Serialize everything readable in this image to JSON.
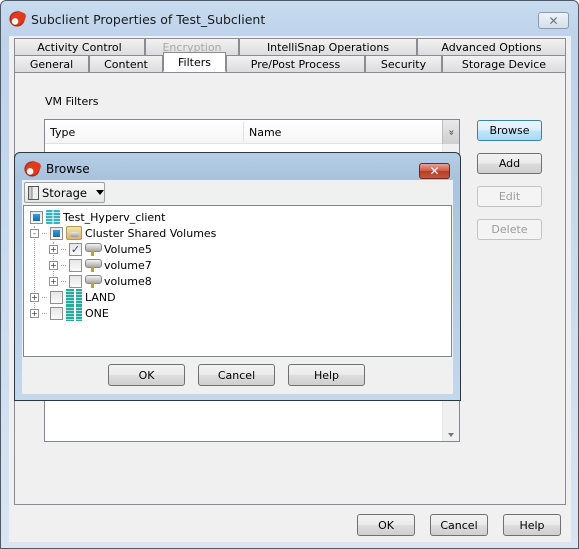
{
  "window": {
    "title": "Subclient Properties of Test_Subclient",
    "close_glyph": "✕"
  },
  "tabs": {
    "row_back": [
      {
        "label": "Activity Control",
        "disabled": false
      },
      {
        "label": "Encryption",
        "disabled": true
      },
      {
        "label": "IntelliSnap Operations",
        "disabled": false
      },
      {
        "label": "Advanced Options",
        "disabled": false
      }
    ],
    "row_front": [
      {
        "label": "General",
        "active": false
      },
      {
        "label": "Content",
        "active": false
      },
      {
        "label": "Filters",
        "active": true
      },
      {
        "label": "Pre/Post Process",
        "active": false
      },
      {
        "label": "Security",
        "active": false
      },
      {
        "label": "Storage Device",
        "active": false
      }
    ]
  },
  "filters": {
    "section_label": "VM Filters",
    "columns": [
      "Type",
      "Name"
    ],
    "more_columns_glyph": "»",
    "buttons": {
      "browse": "Browse",
      "add": "Add",
      "edit": "Edit",
      "delete": "Delete"
    }
  },
  "browse_dialog": {
    "title": "Browse",
    "close_glyph": "✕",
    "view_dropdown": "Storage",
    "tree": [
      {
        "label": "Test_Hyperv_client",
        "icon": "server-icon",
        "state": "partial",
        "level": 0,
        "expander": null
      },
      {
        "label": "Cluster Shared Volumes",
        "icon": "folder-disk-icon",
        "state": "partial",
        "level": 1,
        "expander": "-"
      },
      {
        "label": "Volume5",
        "icon": "disk-icon",
        "state": "checked",
        "level": 2,
        "expander": "+"
      },
      {
        "label": "volume7",
        "icon": "disk-icon",
        "state": "unchecked",
        "level": 2,
        "expander": "+"
      },
      {
        "label": "volume8",
        "icon": "disk-icon",
        "state": "unchecked",
        "level": 2,
        "expander": "+"
      },
      {
        "label": "LAND",
        "icon": "rack-icon",
        "state": "unchecked",
        "level": 1,
        "expander": "+"
      },
      {
        "label": "ONE",
        "icon": "rack-icon",
        "state": "unchecked",
        "level": 1,
        "expander": "+"
      }
    ],
    "buttons": {
      "ok": "OK",
      "cancel": "Cancel",
      "help": "Help"
    }
  },
  "footer": {
    "ok": "OK",
    "cancel": "Cancel",
    "help": "Help"
  }
}
